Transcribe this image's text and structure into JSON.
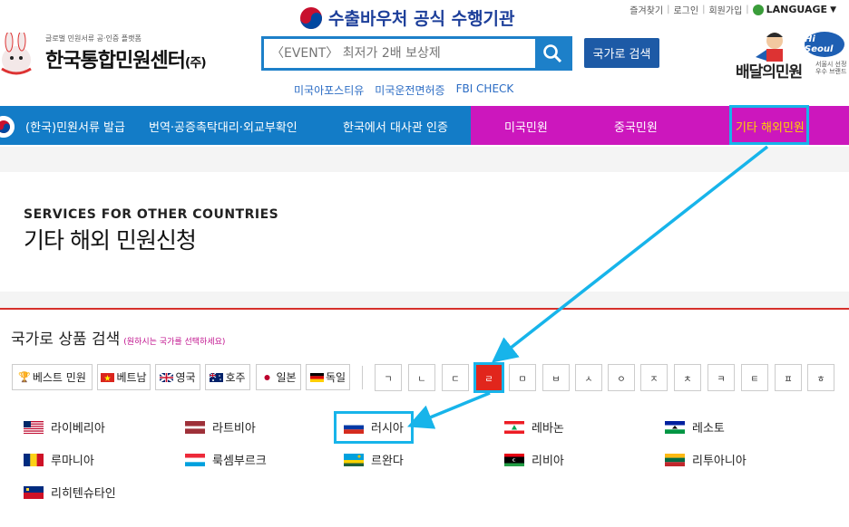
{
  "header": {
    "top_links": [
      "즐겨찾기",
      "로그인",
      "회원가입"
    ],
    "language_label": "LANGUAGE",
    "slogan": "수출바우처 공식 수행기관",
    "logo_sub": "글로벌 민원서류 공·인증 플랫폼",
    "logo_title": "한국통합민원센터",
    "logo_suffix": "(주)",
    "search_placeholder": "〈EVENT〉 최저가 2배 보상제",
    "country_search_label": "국가로 검색",
    "sub_links": [
      "미국아포스티유",
      "미국운전면허증",
      "FBI CHECK"
    ],
    "brand2_title": "배달의민원",
    "brand2_hi": "Hi Seoul",
    "brand2_sub": "서울시 선정 우수 브랜드"
  },
  "nav": {
    "items": [
      "(한국)민원서류 발급",
      "번역·공증촉탁대리·외교부확인",
      "한국에서 대사관 인증",
      "미국민원",
      "중국민원",
      "기타 해외민원"
    ]
  },
  "hero": {
    "en_title": "SERVICES FOR OTHER COUNTRIES",
    "ko_title": "기타 해외 민원신청"
  },
  "product_search": {
    "title": "국가로 상품 검색",
    "hint": "(원하시는 국가를 선택하세요)",
    "chips": [
      "베스트 민원",
      "베트남",
      "영국",
      "호주",
      "일본",
      "독일"
    ],
    "consonants": [
      "ㄱ",
      "ㄴ",
      "ㄷ",
      "ㄹ",
      "ㅁ",
      "ㅂ",
      "ㅅ",
      "ㅇ",
      "ㅈ",
      "ㅊ",
      "ㅋ",
      "ㅌ",
      "ㅍ",
      "ㅎ"
    ],
    "active_consonant": "ㄹ"
  },
  "countries": [
    "라이베리아",
    "라트비아",
    "러시아",
    "레바논",
    "레소토",
    "루마니아",
    "룩셈부르크",
    "르완다",
    "리비아",
    "리투아니아",
    "리히텐슈타인"
  ],
  "colors": {
    "nav_blue": "#137cc7",
    "nav_pink": "#cc17bd",
    "highlight": "#17b4ea",
    "active_red": "#e1261c"
  }
}
